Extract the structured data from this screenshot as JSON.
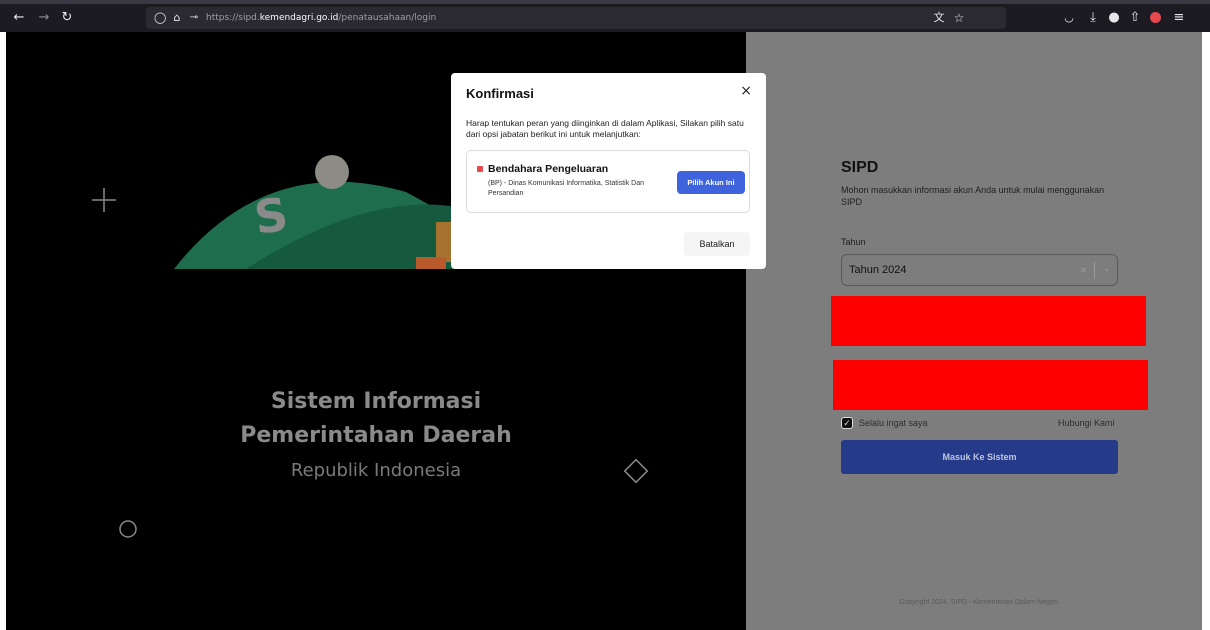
{
  "browser": {
    "url_prefix": "https://sipd.",
    "url_domain": "kemendagri.go.id",
    "url_path": "/penatausahaan/login",
    "icons": [
      "back-icon",
      "forward-icon",
      "reload-icon",
      "shield-icon",
      "lock-icon",
      "key-icon",
      "translate-icon",
      "bookmark-star-icon",
      "pocket-icon",
      "download-icon",
      "extension-icon",
      "share-icon",
      "profile-icon",
      "menu-icon"
    ]
  },
  "hero": {
    "title_line1": "Sistem Informasi",
    "title_line2": "Pemerintahan Daerah",
    "subtitle": "Republik Indonesia"
  },
  "login": {
    "title": "SIPD",
    "description": "Mohon masukkan informasi akun Anda untuk mulai menggunakan SIPD",
    "year_label": "Tahun",
    "year_value": "Tahun 2024",
    "remember_label": "Selalu ingat saya",
    "contact_link": "Hubungi Kami",
    "submit_label": "Masuk Ke Sistem",
    "copyright": "Copyright 2024, SIPD - Kementerian Dalam Negeri."
  },
  "modal": {
    "title": "Konfirmasi",
    "close": "×",
    "message": "Harap tentukan peran yang diinginkan di dalam Aplikasi, Silakan pilih satu dari opsi jabatan berikut ini untuk melanjutkan:",
    "option_title": "Bendahara Pengeluaran",
    "option_desc": "(BP) - Dinas Komunikasi Informatika, Statistik Dan Persandian",
    "pick_label": "Pilih Akun Ini",
    "cancel_label": "Batalkan"
  },
  "colors": {
    "accent": "#3e63dd",
    "redaction": "#ff0000",
    "option_dot": "#e5484d"
  }
}
